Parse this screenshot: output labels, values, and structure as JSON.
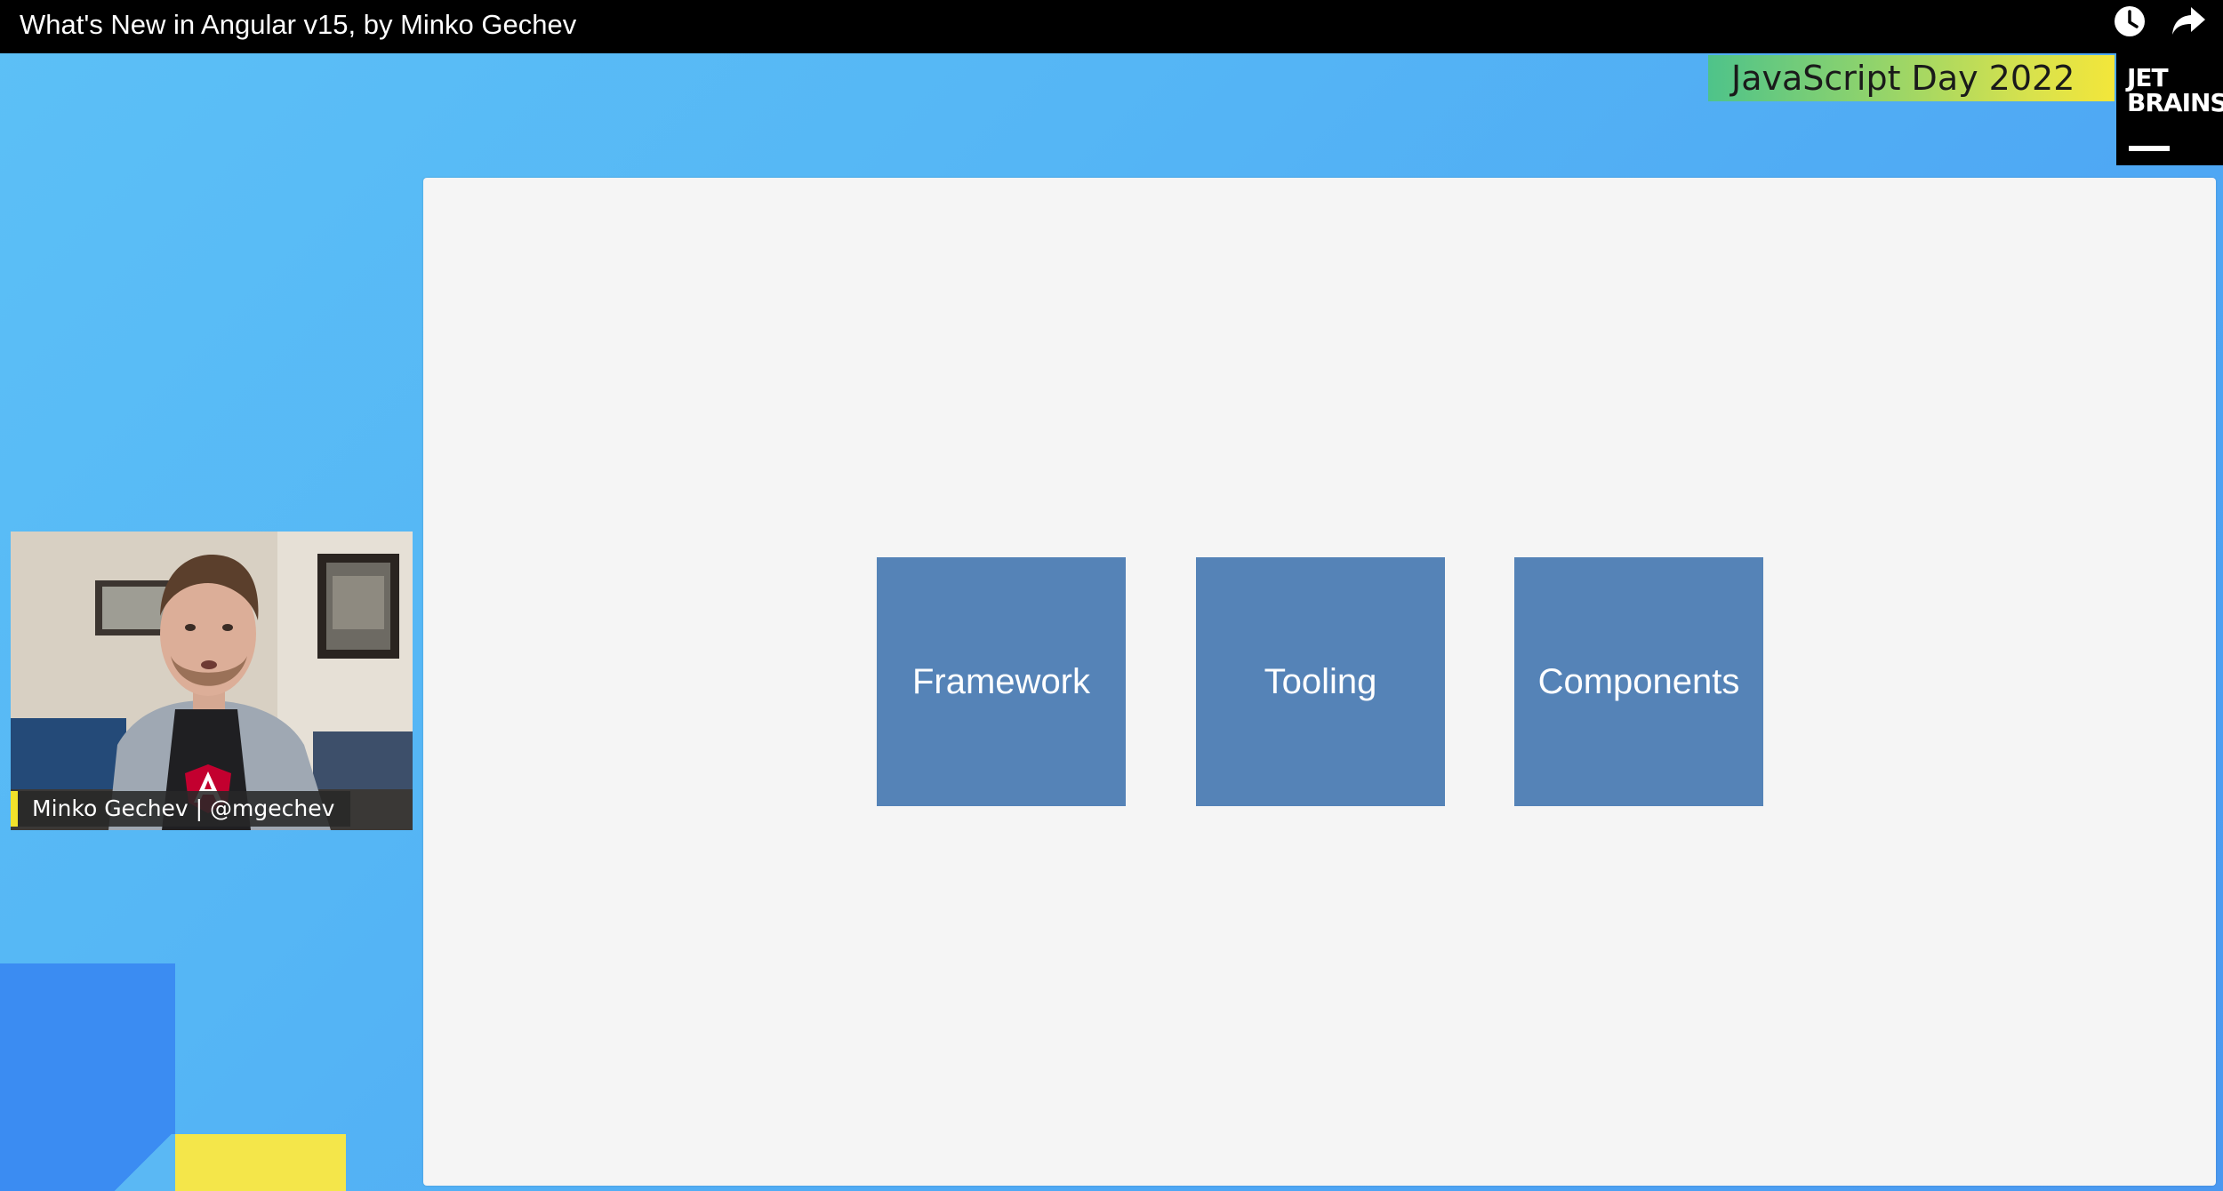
{
  "video": {
    "title": "What's New in Angular v15, by Minko Gechev"
  },
  "controls": {
    "watch_later_icon": "clock-icon",
    "share_icon": "share-arrow-icon"
  },
  "event": {
    "name": "JavaScript Day 2022"
  },
  "logo": {
    "line1": "JET",
    "line2": "BRAINS"
  },
  "slide": {
    "boxes": [
      {
        "label": "Framework"
      },
      {
        "label": "Tooling"
      },
      {
        "label": "Components"
      }
    ],
    "box_color": "#5583b7"
  },
  "speaker": {
    "label": "Minko Gechev | @mgechev"
  },
  "colors": {
    "background": "#55b6f5",
    "accent_yellow": "#f2e22b",
    "accent_blue": "#3b8cf2"
  }
}
